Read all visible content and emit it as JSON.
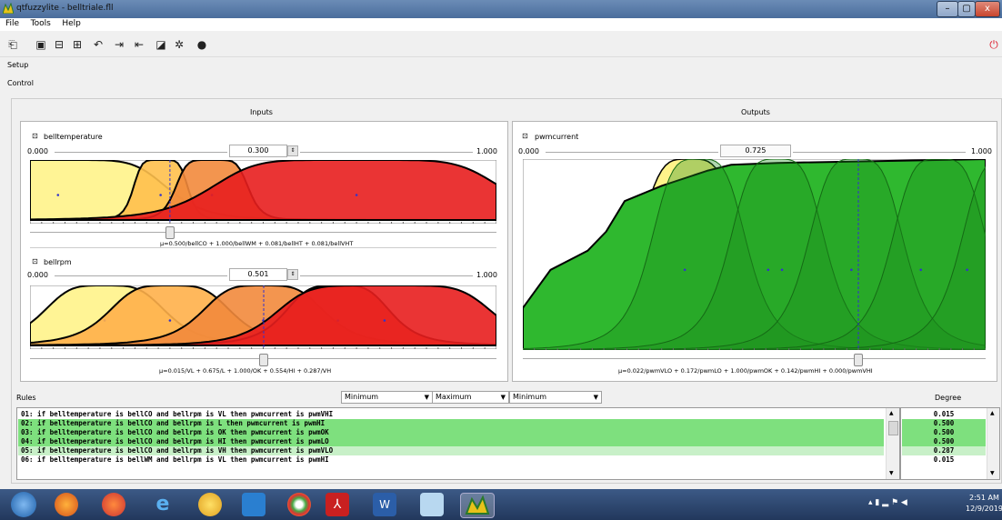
{
  "window": {
    "title": "qtfuzzylite - belltriale.fll",
    "minimize": "–",
    "maximize": "▢",
    "close": "x"
  },
  "menu": [
    "File",
    "Tools",
    "Help"
  ],
  "sections": {
    "setup": "Setup",
    "control": "Control"
  },
  "inputs_title": "Inputs",
  "outputs_title": "Outputs",
  "inputs": [
    {
      "name": "belltemperature",
      "min": "0.000",
      "max": "1.000",
      "value": "0.300",
      "fraction": 0.3,
      "formula": "μ=0.500/bellCO + 1.000/bellWM + 0.081/bellHT + 0.081/bellVHT"
    },
    {
      "name": "bellrpm",
      "min": "0.000",
      "max": "1.000",
      "value": "0.501",
      "fraction": 0.501,
      "formula": "μ=0.015/VL + 0.675/L + 1.000/OK + 0.554/HI + 0.287/VH"
    }
  ],
  "output": {
    "name": "pwmcurrent",
    "min": "0.000",
    "max": "1.000",
    "value": "0.725",
    "fraction": 0.725,
    "formula": "μ=0.022/pwmVLO + 0.172/pwmLO + 1.000/pwmOK + 0.142/pwmHI + 0.000/pwmVHI"
  },
  "rules_label": "Rules",
  "degree_label": "Degree",
  "operators": [
    "Minimum",
    "Maximum",
    "Minimum"
  ],
  "rules": [
    {
      "text": "01: if belltemperature is bellCO and bellrpm is VL then pwmcurrent is pwmVHI",
      "degree": "0.015",
      "highlight": 0
    },
    {
      "text": "02: if belltemperature is bellCO and bellrpm is L then pwmcurrent is pwmHI",
      "degree": "0.500",
      "highlight": 1
    },
    {
      "text": "03: if belltemperature is bellCO and bellrpm is OK then pwmcurrent is pwmOK",
      "degree": "0.500",
      "highlight": 1
    },
    {
      "text": "04: if belltemperature is bellCO and bellrpm is HI then pwmcurrent is pwmLO",
      "degree": "0.500",
      "highlight": 1
    },
    {
      "text": "05: if belltemperature is bellCO and bellrpm is VH then pwmcurrent is pwmVLO",
      "degree": "0.287",
      "highlight": 2
    },
    {
      "text": "06: if belltemperature is bellWM and bellrpm is VL then pwmcurrent is pwmHI",
      "degree": "0.015",
      "highlight": 0
    }
  ],
  "taskbar": {
    "time": "2:51 AM",
    "date": "12/9/2019"
  },
  "colors": {
    "rule_strong": "#7ee07e",
    "rule_light": "#c8f0c8",
    "in_yellow": "#fff38a",
    "in_orange": "#f28a3c",
    "in_red": "#e81e1e",
    "out_green": "#2fb82f"
  }
}
